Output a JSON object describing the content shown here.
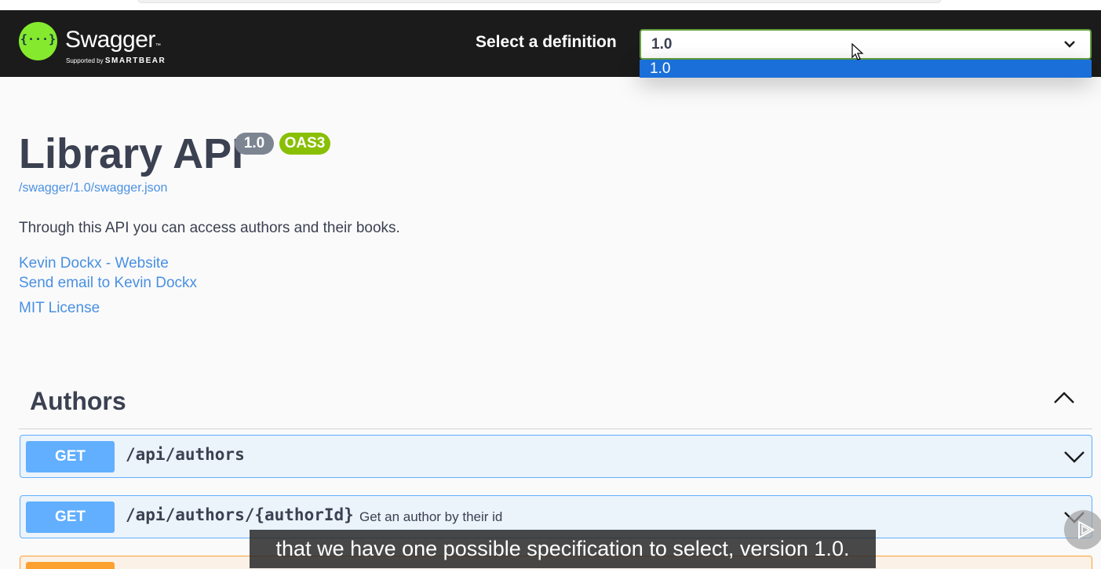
{
  "header": {
    "logo_word": "Swagger",
    "logo_tm": "™",
    "logo_supported_by": "Supported by",
    "logo_brand": "SMARTBEAR",
    "definition_label": "Select a definition",
    "definition_selected": "1.0",
    "definition_options": [
      "1.0"
    ]
  },
  "info": {
    "title": "Library API",
    "version_badge": "1.0",
    "oas_badge": "OAS3",
    "spec_url": "/swagger/1.0/swagger.json",
    "description": "Through this API you can access authors and their books.",
    "contact_website": "Kevin Dockx - Website",
    "contact_email": "Send email to Kevin Dockx",
    "license": "MIT License"
  },
  "sections": [
    {
      "title": "Authors",
      "operations": [
        {
          "method": "GET",
          "path": "/api/authors",
          "summary": ""
        },
        {
          "method": "GET",
          "path": "/api/authors/{authorId}",
          "summary": "Get an author by their id"
        }
      ]
    }
  ],
  "video": {
    "caption": "that we have one possible specification to select, version 1.0."
  },
  "colors": {
    "topbar": "#1b1b1b",
    "logo_green": "#85ea2d",
    "get_blue": "#61affe",
    "link_blue": "#4990e2",
    "oas_green": "#89bf04",
    "selected_option": "#1a6fd9"
  }
}
